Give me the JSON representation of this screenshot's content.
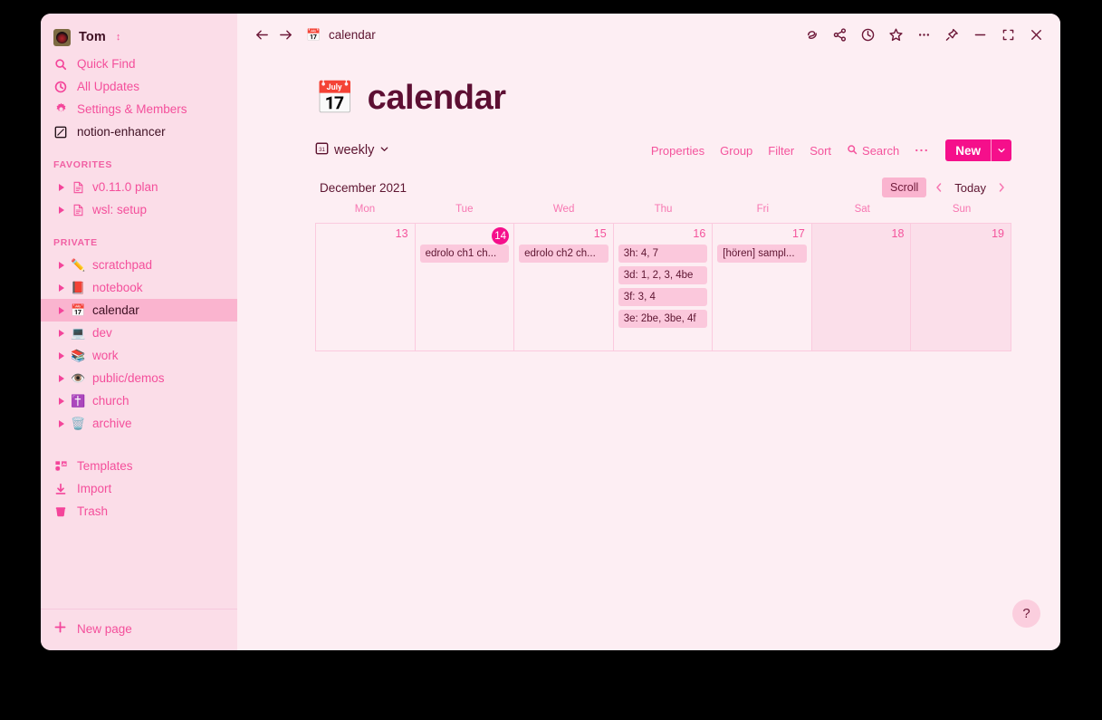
{
  "window": {
    "user": {
      "name": "Tom",
      "avatar_icon": "user-avatar"
    }
  },
  "sidebar": {
    "top_items": [
      {
        "label": "Quick Find",
        "icon": "search-icon"
      },
      {
        "label": "All Updates",
        "icon": "clock-icon"
      },
      {
        "label": "Settings & Members",
        "icon": "gear-icon"
      },
      {
        "label": "notion-enhancer",
        "icon": "notion-enhancer-icon"
      }
    ],
    "favorites_header": "FAVORITES",
    "favorites": [
      {
        "label": "v0.11.0 plan",
        "emoji": "📄"
      },
      {
        "label": "wsl: setup",
        "emoji": "📄"
      }
    ],
    "private_header": "PRIVATE",
    "private": [
      {
        "label": "scratchpad",
        "emoji": "✏️",
        "selected": false
      },
      {
        "label": "notebook",
        "emoji": "📕",
        "selected": false
      },
      {
        "label": "calendar",
        "emoji": "📅",
        "selected": true
      },
      {
        "label": "dev",
        "emoji": "💻",
        "selected": false
      },
      {
        "label": "work",
        "emoji": "📚",
        "selected": false
      },
      {
        "label": "public/demos",
        "emoji": "👁️",
        "selected": false
      },
      {
        "label": "church",
        "emoji": "✝️",
        "selected": false
      },
      {
        "label": "archive",
        "emoji": "🗑️",
        "selected": false
      }
    ],
    "utility_items": [
      {
        "label": "Templates",
        "icon": "templates-icon"
      },
      {
        "label": "Import",
        "icon": "import-icon"
      },
      {
        "label": "Trash",
        "icon": "trash-icon"
      }
    ],
    "new_page_label": "New page"
  },
  "topbar": {
    "back_icon": "arrow-left-icon",
    "forward_icon": "arrow-right-icon",
    "breadcrumb": {
      "emoji": "📅",
      "label": "calendar"
    },
    "icons": [
      "comment-icon",
      "share-icon",
      "history-clock-icon",
      "favorite-star-icon",
      "more-options-icon",
      "pin-icon",
      "minimize-icon",
      "maximize-icon",
      "close-icon"
    ]
  },
  "page": {
    "emoji": "📅",
    "title": "calendar"
  },
  "viewbar": {
    "view_icon": "calendar-view-icon",
    "view_name": "weekly",
    "actions": [
      "Properties",
      "Group",
      "Filter",
      "Sort"
    ],
    "search_label": "Search",
    "more_label": "•••",
    "new_label": "New"
  },
  "calendar": {
    "month": "December 2021",
    "scroll_label": "Scroll",
    "today_label": "Today",
    "daynames": [
      "Mon",
      "Tue",
      "Wed",
      "Thu",
      "Fri",
      "Sat",
      "Sun"
    ],
    "days": [
      {
        "num": "13",
        "today": false,
        "weekend": false,
        "events": []
      },
      {
        "num": "14",
        "today": true,
        "weekend": false,
        "events": [
          "edrolo ch1 ch..."
        ]
      },
      {
        "num": "15",
        "today": false,
        "weekend": false,
        "events": [
          "edrolo ch2 ch..."
        ]
      },
      {
        "num": "16",
        "today": false,
        "weekend": false,
        "events": [
          "3h: 4, 7",
          "3d: 1, 2, 3, 4be",
          "3f: 3, 4",
          "3e: 2be, 3be, 4f"
        ]
      },
      {
        "num": "17",
        "today": false,
        "weekend": false,
        "events": [
          "[hören] sampl..."
        ]
      },
      {
        "num": "18",
        "today": false,
        "weekend": true,
        "events": []
      },
      {
        "num": "19",
        "today": false,
        "weekend": true,
        "events": []
      }
    ]
  },
  "help": {
    "label": "?"
  },
  "colors": {
    "accent": "#f50f8b",
    "sidebar_bg": "#fbdde8",
    "main_bg": "#fdeef3",
    "text_dark": "#5d1430",
    "pink_link": "#f4539c"
  }
}
